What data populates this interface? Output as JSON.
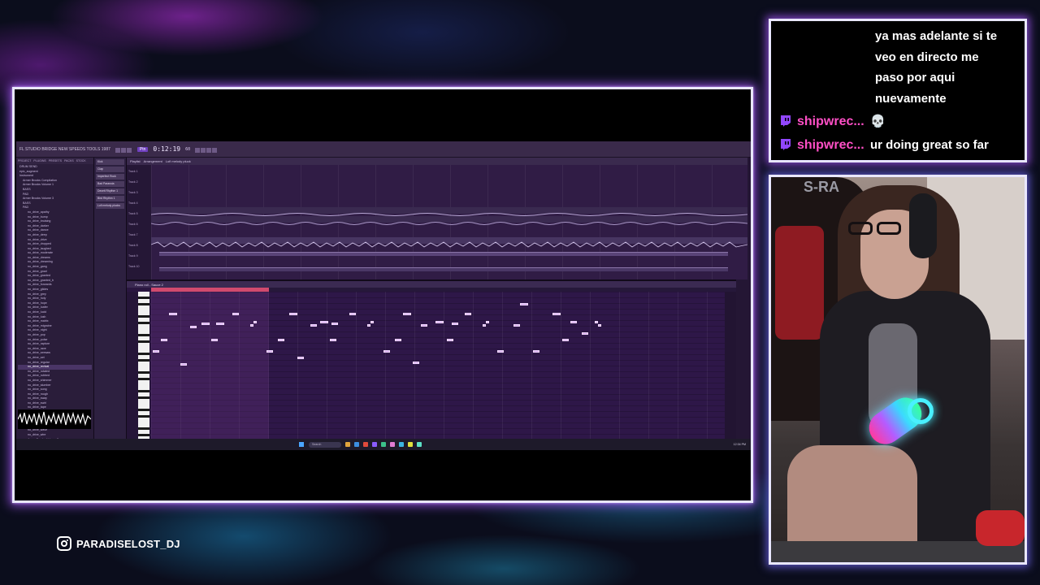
{
  "overlay": {
    "instagram": {
      "icon": "instagram-icon",
      "handle": "PARADISELOST_DJ"
    },
    "accent_purple": "#b45cff",
    "accent_cyan": "#3ad7ff"
  },
  "chat": {
    "messages": [
      {
        "user": "",
        "text_lines": [
          "ya mas adelante si te",
          "veo en directo me",
          "paso por aqui",
          "nuevamente"
        ]
      },
      {
        "user": "shipwrec...",
        "icon": "twitch-icon",
        "text": "💀"
      },
      {
        "user": "shipwrec...",
        "icon": "twitch-icon",
        "text": "ur doing great so far"
      }
    ],
    "username_color": "#ff4fc6"
  },
  "daw": {
    "title": "FL STUDIO  BRIDGE NEW SPEEDS TOOLS 1987",
    "pattern_button": "Ptn",
    "time": "0:12:19",
    "tempo": "60",
    "browser_tabs": [
      "PROJECT",
      "PLUGINS",
      "PRESETS",
      "PACKS",
      "STOCK"
    ],
    "tree": [
      "DRUM SEND",
      "epic_augment",
      "Instrument",
      "Armer Brooks Compilation",
      "Armer Brooks Volume 1",
      "BASS",
      "PAD",
      "Armer Brooks Volume 3",
      "BASS",
      "PAD",
      "no_drive_apathy",
      "no_drive_bump",
      "no_drive_bruising",
      "no_drive_darker",
      "no_drive_dance",
      "no_drive_deep",
      "no_drive_drive",
      "no_drive_dropped",
      "no_drive_laughed",
      "no_drive_moderate",
      "no_drive_dreams",
      "no_drive_dreaming",
      "no_drive_gang",
      "no_drive_gnarl",
      "no_drive_granted",
      "no_drive_granted_b",
      "no_drive_forwards",
      "no_drive_glides",
      "no_drive_grey",
      "no_drive_holy",
      "no_drive_hope",
      "no_drive_loafer",
      "no_drive_lucid",
      "no_drive_lush",
      "no_drive_matrix",
      "no_drive_migraine",
      "no_drive_night",
      "no_drive_pop",
      "no_drive_pulse",
      "no_drive_rapture",
      "no_drive_rave",
      "no_drive_seesaw",
      "no_drive_set",
      "no_drive_regular",
      "no_drive_revival",
      "no_drive_rotated",
      "no_drive_rubbed",
      "no_drive_shimmer",
      "no_drive_slumber",
      "no_drive_song",
      "no_drive_rough",
      "no_drive_sway",
      "no_drive_swirl",
      "no_drive_tape",
      "no_drive_taut",
      "no_drive_time",
      "no_drive_untrue",
      "no_drive_vapor",
      "no_drive_wave",
      "no_drive_wire",
      "Armer Brooks Volume 3",
      "BASS"
    ],
    "channels": [
      "Kick",
      "Clap",
      "Imperfect Rock",
      "Bad Paranoia",
      "Deceit Rhythm 1",
      "Bird Rhythm 1",
      "Lofi melody plucks"
    ],
    "playlist_header": [
      "Playlist",
      "Arrangement",
      "Lofi melody pluck"
    ],
    "track_labels": [
      "Track 1",
      "Track 2",
      "Track 3",
      "Track 4",
      "Track 5",
      "Track 6",
      "Track 7",
      "Track 8",
      "Track 9",
      "Track 10"
    ],
    "pianoroll_title": "Piano roll - Sauce 2",
    "taskbar": {
      "search": "Search",
      "tray_time": "12:34 PM"
    }
  }
}
